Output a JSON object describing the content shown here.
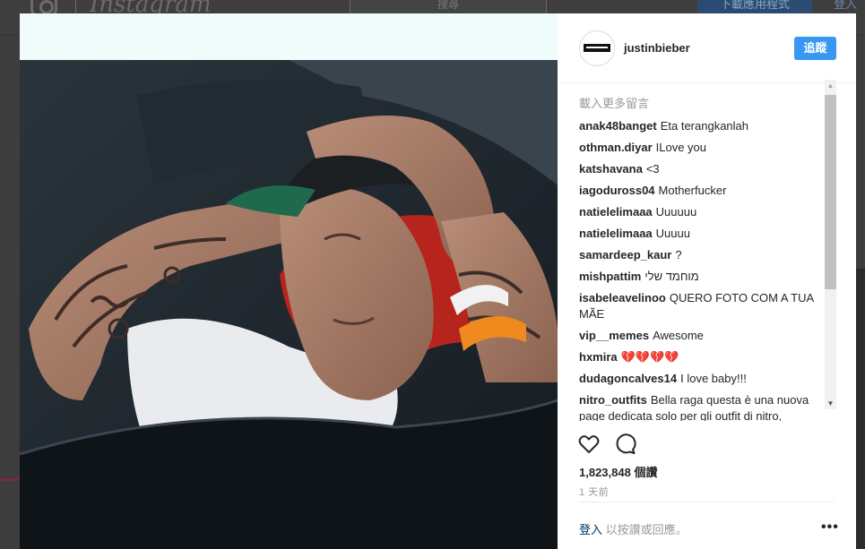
{
  "background": {
    "logo": "Instagram",
    "search_placeholder": "搜尋",
    "download_label": "下載應用程式",
    "login_label": "登入"
  },
  "post": {
    "username": "justinbieber",
    "follow_label": "追蹤",
    "load_more": "載入更多留言",
    "comments": [
      {
        "user": "anak48banget",
        "text": "Eta terangkanlah"
      },
      {
        "user": "othman.diyar",
        "text": "ILove you"
      },
      {
        "user": "katshavana",
        "text": "<3"
      },
      {
        "user": "iagoduross04",
        "text": "Motherfucker"
      },
      {
        "user": "natielelimaaa",
        "text": "Uuuuuu"
      },
      {
        "user": "natielelimaaa",
        "text": "Uuuuu"
      },
      {
        "user": "samardeep_kaur",
        "text": "?"
      },
      {
        "user": "mishpattim",
        "text": "מוחמד שלי"
      },
      {
        "user": "isabeleavelinoo",
        "text": "QUERO FOTO COM A TUA MÃE"
      },
      {
        "user": "vip__memes",
        "text": "Awesome"
      },
      {
        "user": "hxmira",
        "text": "💔💔💔💔"
      },
      {
        "user": "dudagoncalves14",
        "text": "I love baby!!!"
      },
      {
        "user": "nitro_outfits",
        "text": "Bella raga questa è una nuova page dedicata solo per gli outfit di nitro,"
      }
    ],
    "likes": "1,823,848 個讚",
    "time": "1 天前",
    "login_link": "登入",
    "login_suffix": "以按讚或回應。",
    "more_label": "•••"
  },
  "colors": {
    "follow_button": "#3897f0",
    "photo_top_bar": "#f0fcfc",
    "overlay": "#3d3d3d"
  }
}
